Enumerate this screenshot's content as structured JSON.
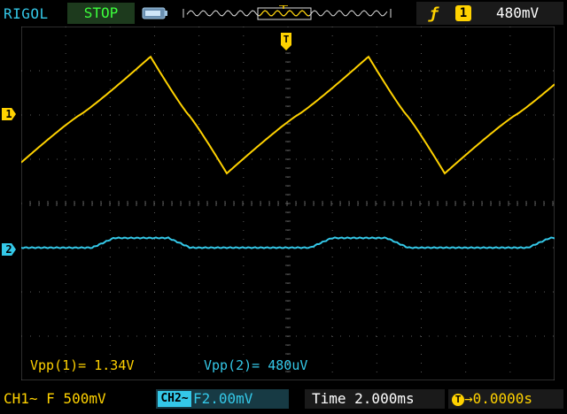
{
  "header": {
    "brand": "RIGOL",
    "run_state": "STOP",
    "trigger_edge_icon": "rising-edge-icon",
    "trigger_source": "1",
    "trigger_level": "480mV"
  },
  "traces": {
    "ch1_marker": "1",
    "ch2_marker": "2",
    "trigger_pos_marker": "T"
  },
  "measurements": {
    "vpp1_label": "Vpp(1)=",
    "vpp1_value": "1.34V",
    "vpp2_label": "Vpp(2)=",
    "vpp2_value": "480uV"
  },
  "footer": {
    "ch1": "CH1∼ F 500mV",
    "ch2_tag": "CH2∼",
    "ch2_scale": "F2.00mV",
    "timebase": "Time 2.000ms",
    "trigger_offset_icon": "T",
    "trigger_offset": "→0.0000s"
  },
  "colors": {
    "ch1": "#ffd200",
    "ch2": "#34c8e8",
    "grid": "#5a5a5a",
    "status": "#3cff3c"
  }
}
